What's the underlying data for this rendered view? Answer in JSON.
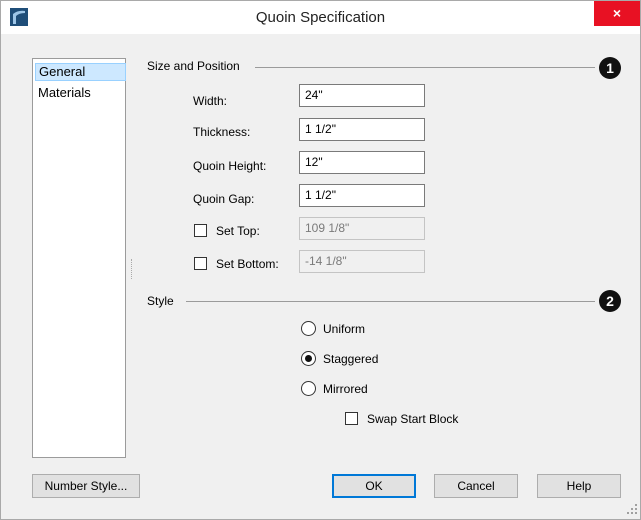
{
  "window": {
    "title": "Quoin Specification",
    "close_glyph": "×",
    "icon": "app-icon"
  },
  "sidebar": {
    "items": [
      {
        "label": "General",
        "selected": true
      },
      {
        "label": "Materials",
        "selected": false
      }
    ]
  },
  "size_position": {
    "title": "Size and Position",
    "badge": "1",
    "fields": [
      {
        "label": "Width:",
        "value": "24\""
      },
      {
        "label": "Thickness:",
        "value": "1 1/2\""
      },
      {
        "label": "Quoin Height:",
        "value": "12\""
      },
      {
        "label": "Quoin Gap:",
        "value": "1 1/2\""
      }
    ],
    "set_top": {
      "label": "Set Top:",
      "value": "109 1/8\"",
      "checked": false
    },
    "set_bottom": {
      "label": "Set Bottom:",
      "value": "-14 1/8\"",
      "checked": false
    }
  },
  "style": {
    "title": "Style",
    "badge": "2",
    "options": [
      {
        "label": "Uniform",
        "selected": false
      },
      {
        "label": "Staggered",
        "selected": true
      },
      {
        "label": "Mirrored",
        "selected": false
      }
    ],
    "swap": {
      "label": "Swap Start Block",
      "checked": false
    }
  },
  "buttons": {
    "number_style": "Number Style...",
    "ok": "OK",
    "cancel": "Cancel",
    "help": "Help"
  },
  "colors": {
    "close_bg": "#e81123",
    "selection_bg": "#cde8ff",
    "default_button_border": "#0078d7"
  }
}
